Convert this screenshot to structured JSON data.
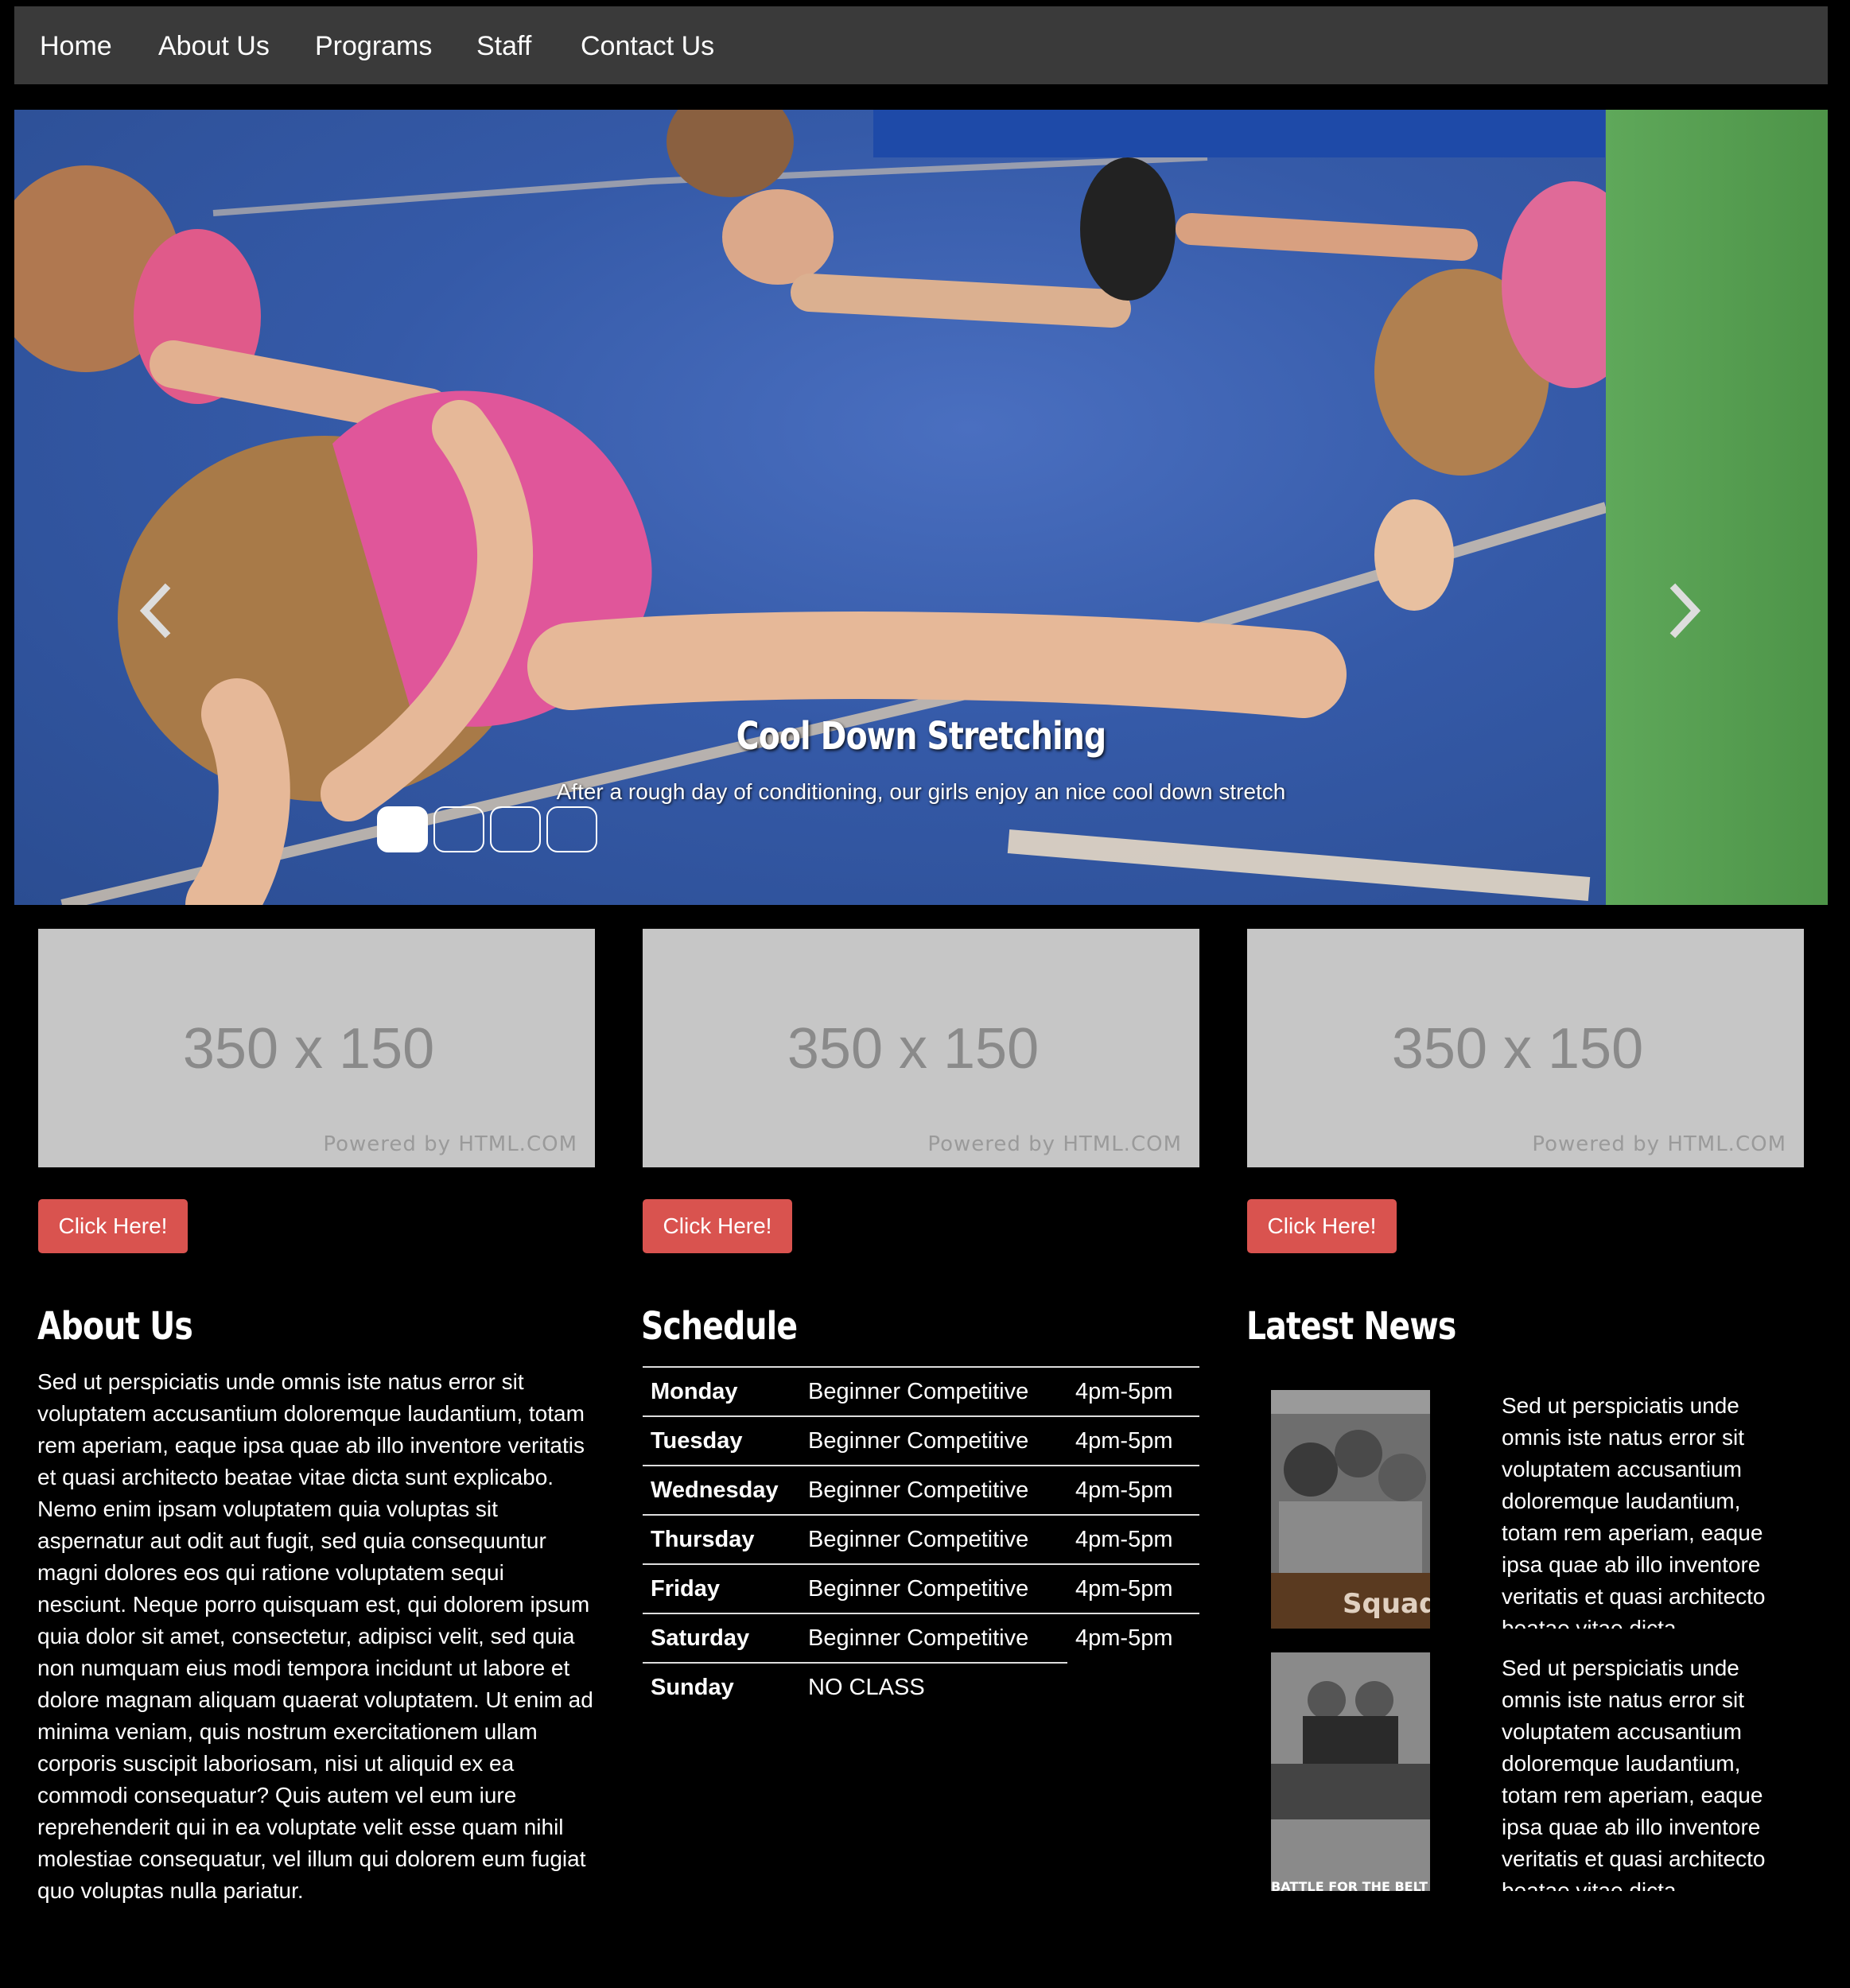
{
  "nav": {
    "items": [
      {
        "label": "Home"
      },
      {
        "label": "About Us"
      },
      {
        "label": "Programs"
      },
      {
        "label": "Staff"
      },
      {
        "label": "Contact Us"
      }
    ]
  },
  "carousel": {
    "title": "Cool Down Stretching",
    "caption": "After a rough day of conditioning, our girls enjoy an nice cool down stretch",
    "prev_icon": "chevron-left-icon",
    "next_icon": "chevron-right-icon",
    "indicator_count": 4,
    "active_index": 0
  },
  "thumbs": [
    {
      "size": "350 x 150",
      "powered": "Powered by HTML.COM",
      "button": "Click Here!"
    },
    {
      "size": "350 x 150",
      "powered": "Powered by HTML.COM",
      "button": "Click Here!"
    },
    {
      "size": "350 x 150",
      "powered": "Powered by HTML.COM",
      "button": "Click Here!"
    }
  ],
  "about": {
    "title": "About Us",
    "text": "Sed ut perspiciatis unde omnis iste natus error sit voluptatem accusantium doloremque laudantium, totam rem aperiam, eaque ipsa quae ab illo inventore veritatis et quasi architecto beatae vitae dicta sunt explicabo. Nemo enim ipsam voluptatem quia voluptas sit aspernatur aut odit aut fugit, sed quia consequuntur magni dolores eos qui ratione voluptatem sequi nesciunt. Neque porro quisquam est, qui dolorem ipsum quia dolor sit amet, consectetur, adipisci velit, sed quia non numquam eius modi tempora incidunt ut labore et dolore magnam aliquam quaerat voluptatem. Ut enim ad minima veniam, quis nostrum exercitationem ullam corporis suscipit laboriosam, nisi ut aliquid ex ea commodi consequatur? Quis autem vel eum iure reprehenderit qui in ea voluptate velit esse quam nihil molestiae consequatur, vel illum qui dolorem eum fugiat quo voluptas nulla pariatur."
  },
  "schedule": {
    "title": "Schedule",
    "rows": [
      {
        "day": "Monday",
        "class": "Beginner Competitive",
        "time": "4pm-5pm"
      },
      {
        "day": "Tuesday",
        "class": "Beginner Competitive",
        "time": "4pm-5pm"
      },
      {
        "day": "Wednesday",
        "class": "Beginner Competitive",
        "time": "4pm-5pm"
      },
      {
        "day": "Thursday",
        "class": "Beginner Competitive",
        "time": "4pm-5pm"
      },
      {
        "day": "Friday",
        "class": "Beginner Competitive",
        "time": "4pm-5pm"
      },
      {
        "day": "Saturday",
        "class": "Beginner Competitive",
        "time": "4pm-5pm"
      },
      {
        "day": "Sunday",
        "class": "NO CLASS",
        "time": ""
      }
    ]
  },
  "news": {
    "title": "Latest News",
    "items": [
      {
        "text": "Sed ut perspiciatis unde omnis iste natus error sit voluptatem accusantium doloremque laudantium, totam rem aperiam, eaque ipsa quae ab illo inventore veritatis et quasi architecto beatae vitae dicta",
        "image_text": "Squad"
      },
      {
        "text": "Sed ut perspiciatis unde omnis iste natus error sit voluptatem accusantium doloremque laudantium, totam rem aperiam, eaque ipsa quae ab illo inventore veritatis et quasi architecto beatae vitae dicta",
        "image_text": "BATTLE FOR THE BELT WINNERS"
      }
    ]
  }
}
